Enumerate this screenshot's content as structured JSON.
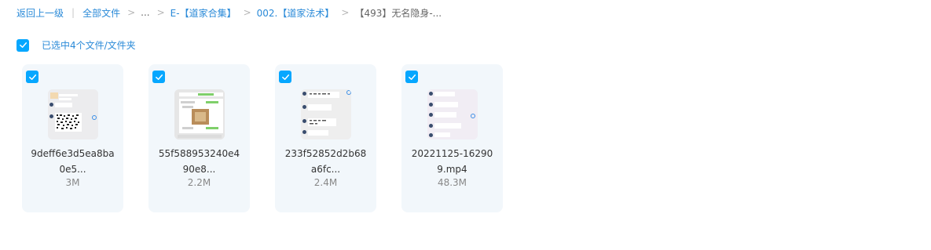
{
  "breadcrumb": {
    "back": "返回上一级",
    "all_files": "全部文件",
    "ellipsis": "...",
    "folder1": "E-【道家合集】",
    "folder2": "002.【道家法术】",
    "current": "【493】无名隐身-..."
  },
  "selection": {
    "label": "已选中4个文件/文件夹"
  },
  "files": [
    {
      "name_line1": "9deff6e3d5ea8ba",
      "name_line2": "0e5...",
      "size": "3M"
    },
    {
      "name_line1": "55f588953240e4",
      "name_line2": "90e8...",
      "size": "2.2M"
    },
    {
      "name_line1": "233f52852d2b68",
      "name_line2": "a6fc...",
      "size": "2.4M"
    },
    {
      "name_line1": "20221125-16290",
      "name_line2": "9.mp4",
      "size": "48.3M"
    }
  ],
  "colors": {
    "accent": "#06a7ff",
    "link": "#2a8ad8",
    "card_bg": "#f2f7fb"
  }
}
